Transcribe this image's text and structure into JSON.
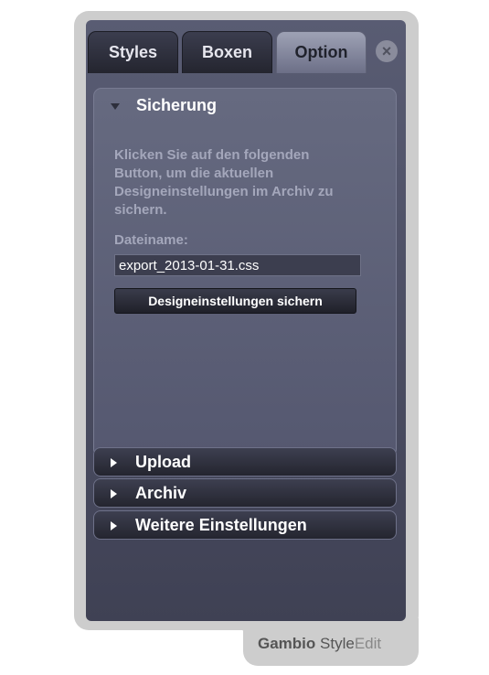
{
  "tabs": [
    {
      "label": "Styles",
      "active": false
    },
    {
      "label": "Boxen",
      "active": false
    },
    {
      "label": "Option",
      "active": true
    }
  ],
  "close_icon": "close-icon",
  "backup": {
    "title": "Sicherung",
    "description": "Klicken Sie auf den folgenden Button, um die aktuellen Designeinstellungen im Archiv zu sichern.",
    "filename_label": "Dateiname:",
    "filename_value": "export_2013-01-31.css",
    "save_button": "Designeinstellungen sichern"
  },
  "accordion": [
    {
      "label": "Upload"
    },
    {
      "label": "Archiv"
    },
    {
      "label": "Weitere Einstellungen"
    }
  ],
  "brand": {
    "part1": "Gambio",
    "part2": "Style",
    "part3": "Edit"
  },
  "colors": {
    "panel": "#4f5268",
    "active_tab": "#9ea2b5",
    "frame": "#cdcdcd"
  }
}
